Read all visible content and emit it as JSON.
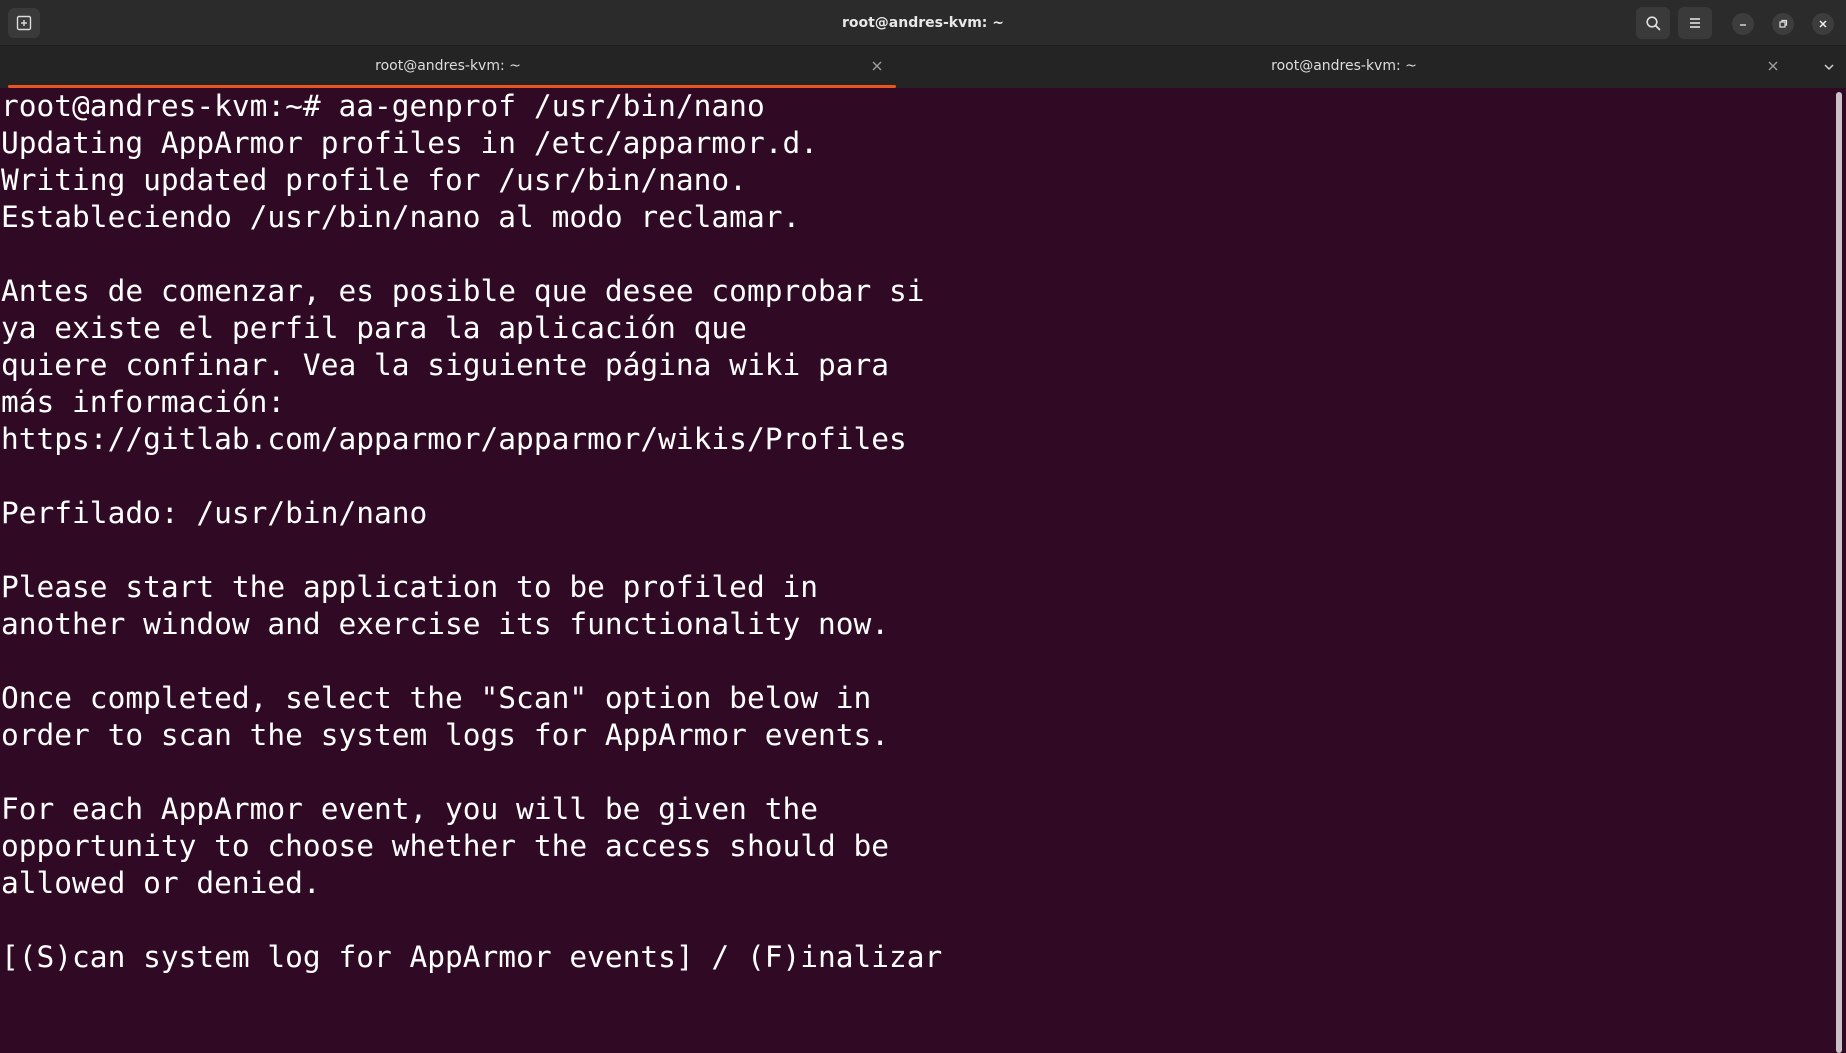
{
  "window": {
    "title": "root@andres-kvm: ~"
  },
  "tabs": [
    {
      "label": "root@andres-kvm: ~",
      "active": true
    },
    {
      "label": "root@andres-kvm: ~",
      "active": false
    }
  ],
  "icons": {
    "new_tab": "new-tab-icon",
    "search": "search-icon",
    "menu": "hamburger-menu-icon",
    "minimize": "minimize-icon",
    "maximize": "restore-icon",
    "close": "close-icon",
    "tab_close": "close-icon",
    "tab_list": "chevron-down-icon"
  },
  "colors": {
    "terminal_bg": "#300a24",
    "terminal_fg": "#ffffff",
    "accent": "#e95420",
    "titlebar_bg": "#2b2b2b",
    "tabbar_bg": "#242424"
  },
  "terminal": {
    "lines": [
      "root@andres-kvm:~# aa-genprof /usr/bin/nano",
      "Updating AppArmor profiles in /etc/apparmor.d.",
      "Writing updated profile for /usr/bin/nano.",
      "Estableciendo /usr/bin/nano al modo reclamar.",
      "",
      "Antes de comenzar, es posible que desee comprobar si",
      "ya existe el perfil para la aplicación que",
      "quiere confinar. Vea la siguiente página wiki para",
      "más información:",
      "https://gitlab.com/apparmor/apparmor/wikis/Profiles",
      "",
      "Perfilado: /usr/bin/nano",
      "",
      "Please start the application to be profiled in",
      "another window and exercise its functionality now.",
      "",
      "Once completed, select the \"Scan\" option below in",
      "order to scan the system logs for AppArmor events.",
      "",
      "For each AppArmor event, you will be given the",
      "opportunity to choose whether the access should be",
      "allowed or denied.",
      "",
      "[(S)can system log for AppArmor events] / (F)inalizar"
    ]
  }
}
